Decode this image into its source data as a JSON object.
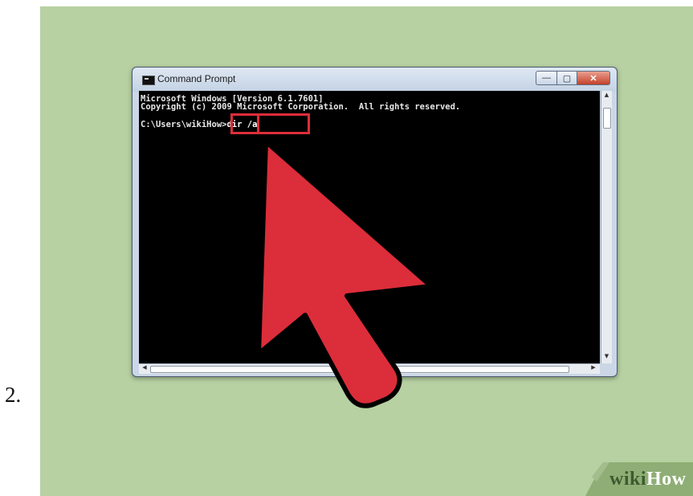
{
  "step": {
    "number": "2."
  },
  "window": {
    "title": "Command Prompt",
    "buttons": {
      "minimize": "—",
      "maximize": "▢",
      "close": "✕"
    }
  },
  "console": {
    "line1": "Microsoft Windows [Version 6.1.7601]",
    "line2": "Copyright (c) 2009 Microsoft Corporation.  All rights reserved.",
    "prompt": "C:\\Users\\wikiHow>",
    "command": "dir /a"
  },
  "logo": {
    "wiki": "wiki",
    "how": "How"
  },
  "colors": {
    "panel": "#b7d1a2",
    "highlight": "#dc2d3a",
    "pointer": "#dc2d3a",
    "console_bg": "#000000"
  },
  "icons": {
    "app": "command-prompt-icon",
    "pointer": "cursor-arrow-icon"
  }
}
